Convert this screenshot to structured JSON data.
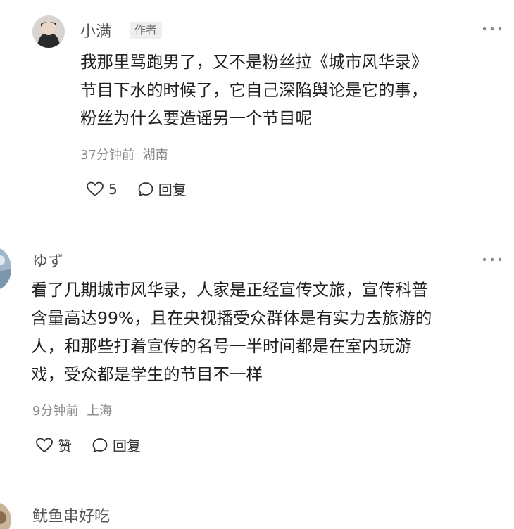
{
  "comments": [
    {
      "user": "小满",
      "badge": "作者",
      "content": "我那里骂跑男了，又不是粉丝拉《城市风华录》\n节目下水的时候了，它自己深陷舆论是它的事，\n粉丝为什么要造谣另一个节目呢",
      "time": "37分钟前",
      "location": "湖南",
      "like_label": "5",
      "reply_label": "回复"
    },
    {
      "user": "ゆず",
      "content": "看了几期城市风华录，人家是正经宣传文旅，宣传科普\n含量高达99%，且在央视播受众群体是有实力去旅游的\n人，和那些打着宣传的名号一半时间都是在室内玩游\n戏，受众都是学生的节目不一样",
      "time": "9分钟前",
      "location": "上海",
      "like_label": "赞",
      "reply_label": "回复"
    },
    {
      "user": "鱿鱼串好吃"
    }
  ],
  "more_glyph": "⋮⋮",
  "colors": {
    "text": "#1f1f1f",
    "meta": "#8a8a8a",
    "icon": "#333333"
  },
  "icons": {
    "like": "heart-outline-icon",
    "reply": "speech-bubble-icon",
    "more": "more-dots-icon"
  }
}
